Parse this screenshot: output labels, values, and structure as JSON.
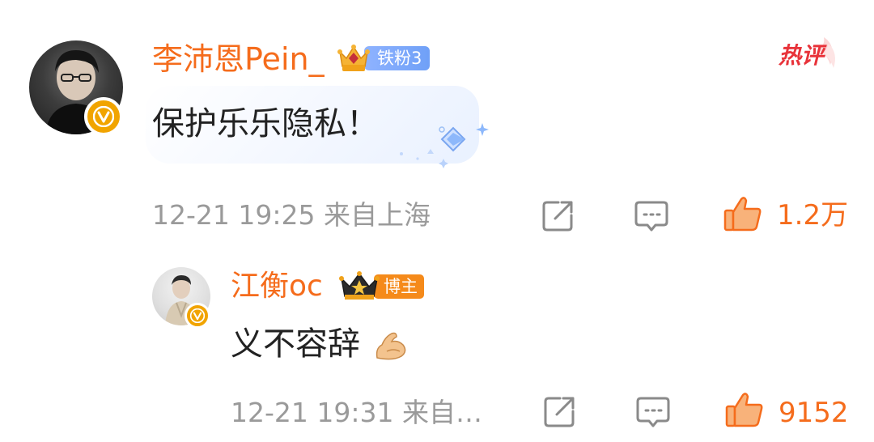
{
  "colors": {
    "username": "#f56c1c",
    "meta_text": "#9a9a9a",
    "body_text": "#222222",
    "like_orange": "#f56c1c",
    "fan_badge_blue": "#7aa6fb",
    "blogger_badge_orange": "#f58a1a",
    "verified_gold": "#f1a400",
    "hot_red": "#e8333a"
  },
  "hot_tag": {
    "label": "热评",
    "icon": "hot-comment-tag"
  },
  "main_comment": {
    "avatar_icon": "user-avatar",
    "verified_icon": "verified-v-badge",
    "username": "李沛恩Pein_",
    "fan_badge": {
      "icon": "crown-fan-icon",
      "label": "铁粉3"
    },
    "text": "保护乐乐隐私！",
    "decoration_icon": "diamond-sparkle-decoration",
    "timestamp": "12-21 19:25",
    "location": "来自上海",
    "share_icon": "share-icon",
    "reply_icon": "comment-icon",
    "like_icon": "thumbs-up-icon",
    "like_count": "1.2万"
  },
  "reply_comment": {
    "avatar_icon": "user-avatar",
    "verified_icon": "verified-v-badge",
    "username": "江衡oc",
    "role_badge": {
      "icon": "crown-blogger-icon",
      "label": "博主"
    },
    "text": "义不容辞",
    "emoji_icon": "flexed-biceps-emoji",
    "timestamp": "12-21 19:31",
    "location": "来自…",
    "share_icon": "share-icon",
    "reply_icon": "comment-icon",
    "like_icon": "thumbs-up-icon",
    "like_count": "9152"
  }
}
